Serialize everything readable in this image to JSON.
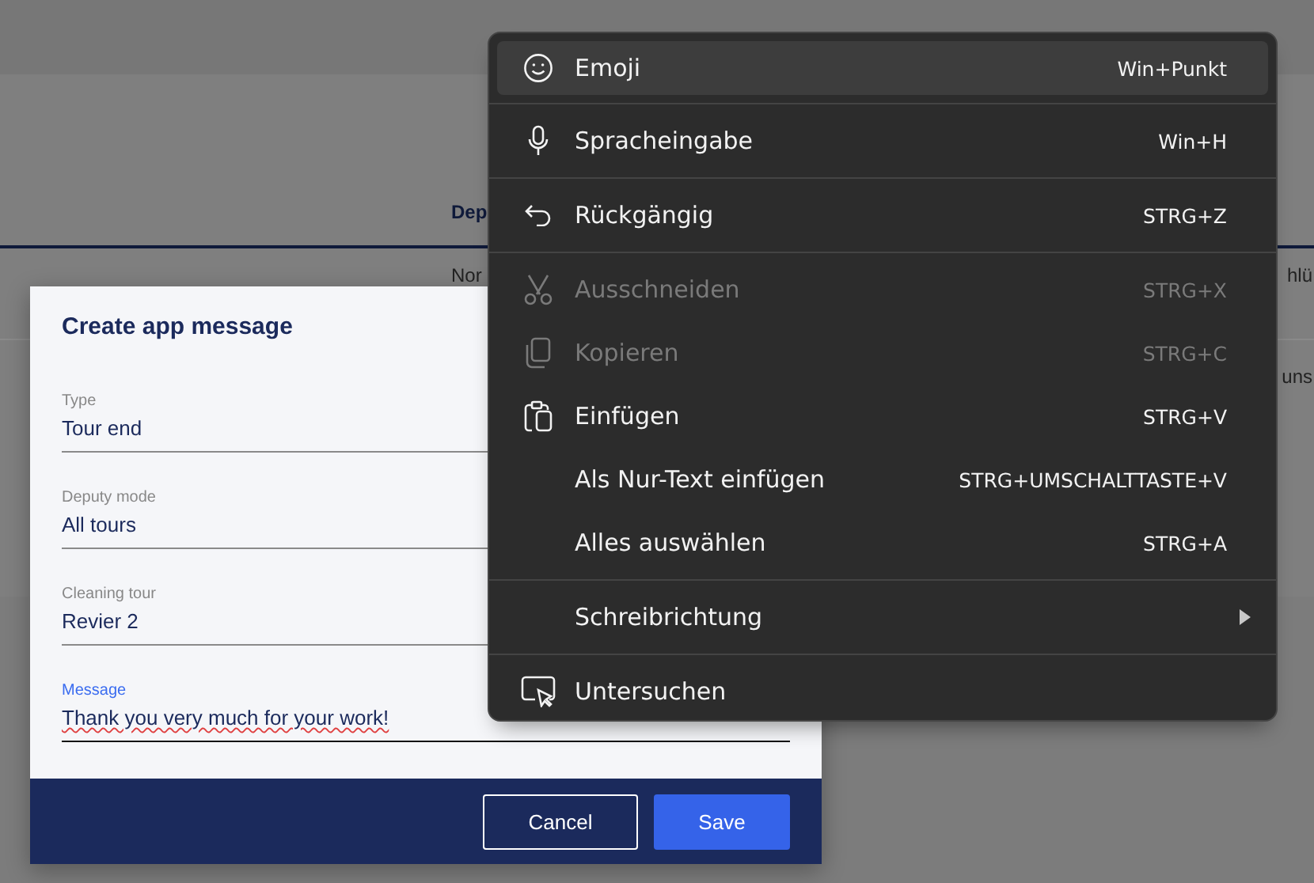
{
  "background_page": {
    "column_header": "Dep",
    "cells": [
      "Nor",
      "hlü",
      "uns"
    ]
  },
  "dialog": {
    "title": "Create app message",
    "fields": [
      {
        "label": "Type",
        "value": "Tour end",
        "focused": false,
        "spellcheck_error": false
      },
      {
        "label": "Deputy mode",
        "value": "All tours",
        "focused": false,
        "spellcheck_error": false
      },
      {
        "label": "Cleaning tour",
        "value": "Revier 2",
        "focused": false,
        "spellcheck_error": false
      },
      {
        "label": "Message",
        "value": "Thank you very much for your work!",
        "focused": true,
        "spellcheck_error": true
      }
    ],
    "buttons": [
      {
        "label": "Cancel",
        "kind": "secondary"
      },
      {
        "label": "Save",
        "kind": "primary"
      }
    ]
  },
  "context_menu": {
    "groups": [
      [
        {
          "label": "Emoji",
          "shortcut": "Win+Punkt",
          "disabled": false,
          "selected": true,
          "submenu": false
        }
      ],
      [
        {
          "label": "Spracheingabe",
          "shortcut": "Win+H",
          "disabled": false,
          "selected": false,
          "submenu": false
        }
      ],
      [
        {
          "label": "Rückgängig",
          "shortcut": "STRG+Z",
          "disabled": false,
          "selected": false,
          "submenu": false
        }
      ],
      [
        {
          "label": "Ausschneiden",
          "shortcut": "STRG+X",
          "disabled": true,
          "selected": false,
          "submenu": false
        },
        {
          "label": "Kopieren",
          "shortcut": "STRG+C",
          "disabled": true,
          "selected": false,
          "submenu": false
        },
        {
          "label": "Einfügen",
          "shortcut": "STRG+V",
          "disabled": false,
          "selected": false,
          "submenu": false
        },
        {
          "label": "Als Nur-Text einfügen",
          "shortcut": "STRG+UMSCHALTTASTE+V",
          "disabled": false,
          "selected": false,
          "submenu": false
        },
        {
          "label": "Alles auswählen",
          "shortcut": "STRG+A",
          "disabled": false,
          "selected": false,
          "submenu": false
        }
      ],
      [
        {
          "label": "Schreibrichtung",
          "disabled": false,
          "selected": false,
          "submenu": true
        }
      ],
      [
        {
          "label": "Untersuchen",
          "disabled": false,
          "selected": false,
          "submenu": false
        }
      ]
    ]
  }
}
